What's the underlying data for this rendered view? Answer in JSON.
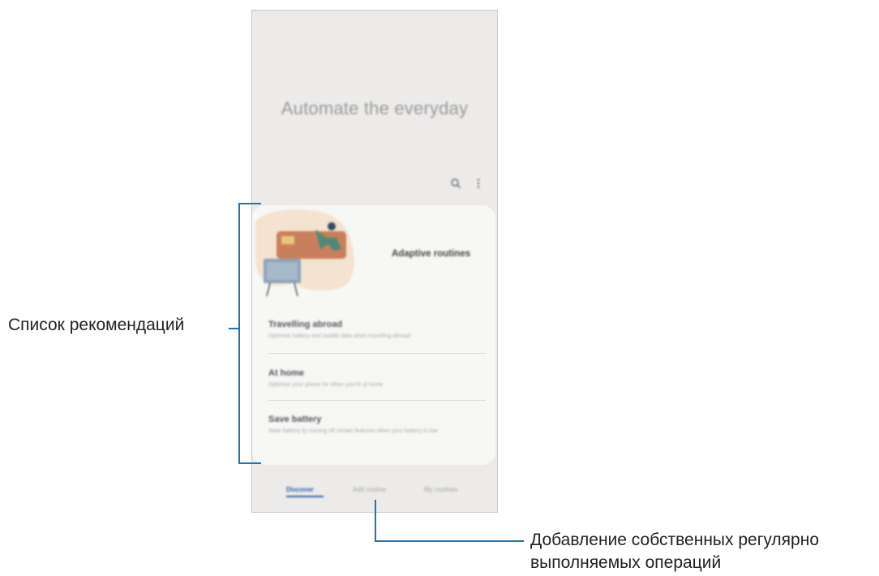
{
  "app": {
    "hero_title": "Automate the everyday"
  },
  "card": {
    "heading": "Adaptive routines",
    "items": [
      {
        "title": "Travelling abroad",
        "subtitle": "Optimise battery and mobile data when travelling abroad"
      },
      {
        "title": "At home",
        "subtitle": "Optimise your phone for when you're at home"
      },
      {
        "title": "Save battery",
        "subtitle": "Save battery by turning off certain features when your battery is low"
      }
    ]
  },
  "bottom_nav": {
    "tabs": [
      "Discover",
      "Add routine",
      "My routines"
    ],
    "active": "Discover"
  },
  "annotations": {
    "recommendations_list": "Список рекомендаций",
    "add_own_line1": "Добавление собственных регулярно",
    "add_own_line2": "выполняемых операций"
  },
  "colors": {
    "accent": "#1b75bc",
    "tab_active": "#2a5ea8",
    "screen_bg": "#ecebea",
    "card_bg": "#f7f7f6"
  },
  "icons": [
    "search-icon",
    "more-vert-icon"
  ]
}
